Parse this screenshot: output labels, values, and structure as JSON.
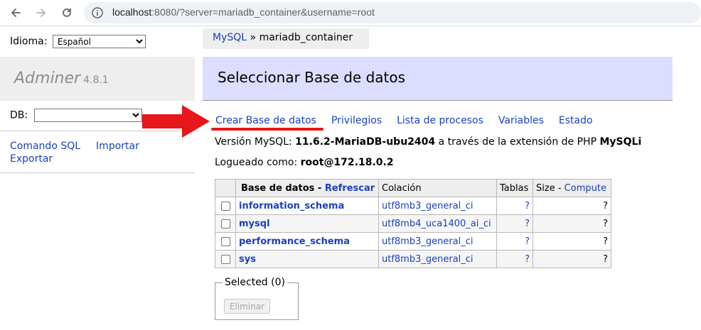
{
  "browser": {
    "url_host": "localhost",
    "url_rest": ":8080/?server=mariadb_container&username=root",
    "icons": [
      "arrow-left-icon",
      "arrow-right-icon",
      "reload-icon",
      "info-icon"
    ]
  },
  "sidebar": {
    "language_label": "Idioma:",
    "language_value": "Español",
    "app_name": "Adminer",
    "app_version": "4.8.1",
    "db_label": "DB:",
    "db_value": "",
    "links": {
      "sql_command": "Comando SQL",
      "import": "Importar",
      "export": "Exportar"
    }
  },
  "breadcrumb": {
    "driver": "MySQL",
    "separator": "»",
    "server": "mariadb_container"
  },
  "page_title": "Seleccionar Base de datos",
  "menu": {
    "create_db": "Crear Base de datos",
    "privileges": "Privilegios",
    "processes": "Lista de procesos",
    "variables": "Variables",
    "status": "Estado"
  },
  "version_line": {
    "prefix": "Versión MySQL:",
    "version": "11.6.2-MariaDB-ubu2404",
    "middle": "a través de la extensión de PHP",
    "extension": "MySQLi"
  },
  "login_line": {
    "prefix": "Logueado como:",
    "user": "root@172.18.0.2"
  },
  "table": {
    "header_db": "Base de datos",
    "header_sep": "-",
    "header_refresh": "Refrescar",
    "header_collation": "Colación",
    "header_tables": "Tablas",
    "header_size": "Size",
    "header_size_sep": "-",
    "header_compute": "Compute",
    "rows": [
      {
        "name": "information_schema",
        "collation": "utf8mb3_general_ci",
        "tables": "?",
        "size": "?"
      },
      {
        "name": "mysql",
        "collation": "utf8mb4_uca1400_ai_ci",
        "tables": "?",
        "size": "?"
      },
      {
        "name": "performance_schema",
        "collation": "utf8mb3_general_ci",
        "tables": "?",
        "size": "?"
      },
      {
        "name": "sys",
        "collation": "utf8mb3_general_ci",
        "tables": "?",
        "size": "?"
      }
    ]
  },
  "selected": {
    "legend": "Selected (0)",
    "delete_button": "Eliminar"
  },
  "annotation_color": "#e8171c",
  "link_color": "#1a3fc1",
  "title_background": "#ddddff"
}
